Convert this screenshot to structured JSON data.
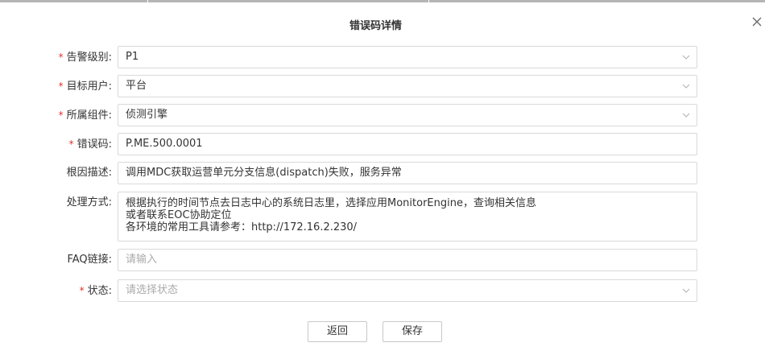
{
  "dialog": {
    "title": "错误码详情",
    "close_icon": "close-icon"
  },
  "form": {
    "required_mark": "*",
    "alarm_level": {
      "label": "告警级别:",
      "value": "P1"
    },
    "target_user": {
      "label": "目标用户:",
      "value": "平台"
    },
    "component": {
      "label": "所属组件:",
      "value": "侦测引擎"
    },
    "error_code": {
      "label": "错误码:",
      "value": "P.ME.500.0001"
    },
    "root_cause": {
      "label": "根因描述:",
      "value": "调用MDC获取运营单元分支信息(dispatch)失败，服务异常"
    },
    "handling": {
      "label": "处理方式:",
      "lines": [
        "根据执行的时间节点去日志中心的系统日志里，选择应用MonitorEngine，查询相关信息",
        "或者联系EOC协助定位",
        "各环境的常用工具请参考：http://172.16.2.230/"
      ]
    },
    "faq_link": {
      "label": "FAQ链接:",
      "placeholder": "请输入"
    },
    "status": {
      "label": "状态:",
      "placeholder": "请选择状态"
    }
  },
  "buttons": {
    "back": "返回",
    "save": "保存"
  }
}
